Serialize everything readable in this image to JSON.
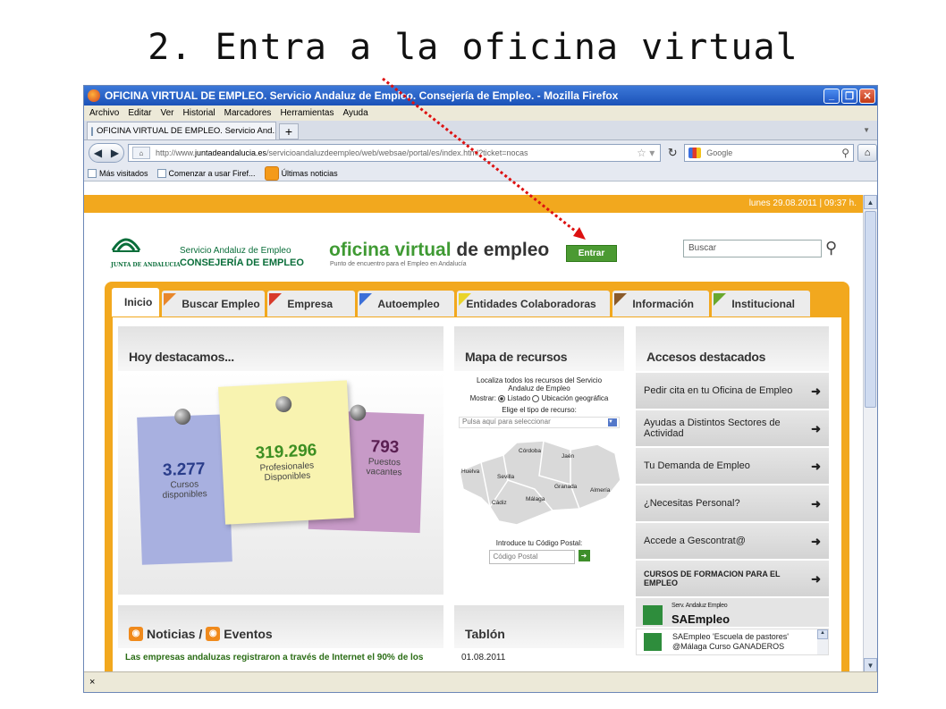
{
  "slide": {
    "title": "2.  Entra a la oficina virtual"
  },
  "browser": {
    "window_title": "OFICINA VIRTUAL DE EMPLEO. Servicio Andaluz de Empleo. Consejería de Empleo. - Mozilla Firefox",
    "menu": [
      "Archivo",
      "Editar",
      "Ver",
      "Historial",
      "Marcadores",
      "Herramientas",
      "Ayuda"
    ],
    "tab_label": "OFICINA VIRTUAL DE EMPLEO. Servicio And...",
    "url_prefix": "http://www.",
    "url_domain": "juntadeandalucia.es",
    "url_rest": "/servicioandaluzdeempleo/web/websae/portal/es/index.html?ticket=nocas",
    "search_placeholder": "Google",
    "bookmarks": [
      "Más visitados",
      "Comenzar a usar Firef...",
      "Últimas noticias"
    ],
    "status_close": "×"
  },
  "site": {
    "date_time": "lunes 29.08.2011 | 09:37 h.",
    "logo_junta": "JUNTA DE ANDALUCIA",
    "logo_line1": "Servicio Andaluz de Empleo",
    "logo_line2": "CONSEJERÍA DE EMPLEO",
    "ov_title_green": "oficina virtual",
    "ov_title_dark": " de empleo",
    "ov_subtitle": "Punto de encuentro para el Empleo en Andalucía",
    "entrar_label": "Entrar",
    "buscar_placeholder": "Buscar",
    "tabs": [
      {
        "label": "Inicio",
        "color": ""
      },
      {
        "label": "Buscar Empleo",
        "color": "#e8872c"
      },
      {
        "label": "Empresa",
        "color": "#d83a2a"
      },
      {
        "label": "Autoempleo",
        "color": "#3b6fd8"
      },
      {
        "label": "Entidades Colaboradoras",
        "color": "#e9d42a"
      },
      {
        "label": "Información",
        "color": "#8a5a2a"
      },
      {
        "label": "Institucional",
        "color": "#6aa82e"
      }
    ],
    "highlights": {
      "heading": "Hoy destacamos...",
      "cursos_value": "3.277",
      "cursos_label1": "Cursos",
      "cursos_label2": "disponibles",
      "prof_value": "319.296",
      "prof_label1": "Profesionales",
      "prof_label2": "Disponibles",
      "puestos_value": "793",
      "puestos_label1": "Puestos",
      "puestos_label2": "vacantes"
    },
    "map": {
      "heading": "Mapa de recursos",
      "intro1": "Localiza todos los recursos del Servicio",
      "intro2": "Andaluz de Empleo",
      "mostrar": "Mostrar:",
      "opt_listado": "Listado",
      "opt_geo": "Ubicación geográfica",
      "elige": "Elige el tipo de recurso:",
      "select_placeholder": "Pulsa aquí para seleccionar",
      "provinces": [
        "Córdoba",
        "Jaén",
        "Huelva",
        "Sevilla",
        "Granada",
        "Almería",
        "Málaga",
        "Cádiz"
      ],
      "cp_label": "Introduce tu Código Postal:",
      "cp_placeholder": "Código Postal"
    },
    "accesos": {
      "heading": "Accesos destacados",
      "items": [
        "Pedir cita en tu Oficina de Empleo",
        "Ayudas a Distintos Sectores de Actividad",
        "Tu Demanda de Empleo",
        "¿Necesitas Personal?",
        "Accede a Gescontrat@",
        "CURSOS DE FORMACION PARA EL EMPLEO"
      ],
      "sae_small": "Serv. Andaluz Empleo",
      "sae_big": "SAEmpleo",
      "tweet": "SAEmpleo 'Escuela de pastores' @Málaga Curso GANADEROS"
    },
    "news": {
      "noticias": "Noticias /",
      "eventos": "Eventos",
      "headline": "Las empresas andaluzas registraron a través de Internet el 90% de los"
    },
    "tablon": {
      "heading": "Tablón",
      "date": "01.08.2011"
    }
  }
}
